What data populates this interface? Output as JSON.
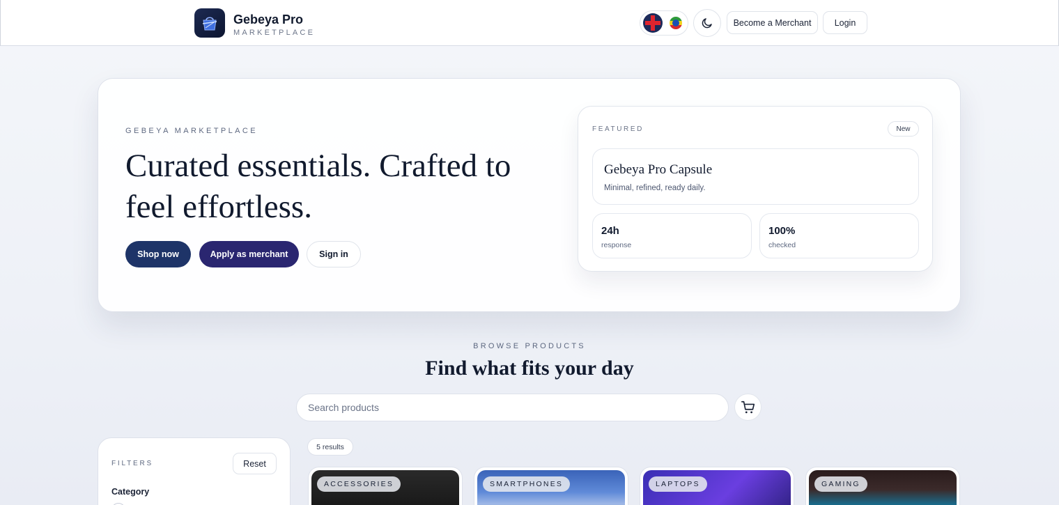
{
  "header": {
    "brand_name": "Gebeya Pro",
    "brand_sub": "MARKETPLACE",
    "become_merchant": "Become a Merchant",
    "login": "Login"
  },
  "hero": {
    "eyebrow": "GEBEYA MARKETPLACE",
    "title": "Curated essentials. Crafted to feel effortless.",
    "shop_now": "Shop now",
    "apply_merchant": "Apply as merchant",
    "sign_in": "Sign in",
    "featured": {
      "eyebrow": "FEATURED",
      "badge": "New",
      "title": "Gebeya Pro Capsule",
      "description": "Minimal, refined, ready daily.",
      "stats": [
        {
          "value": "24h",
          "label": "response"
        },
        {
          "value": "100%",
          "label": "checked"
        }
      ]
    }
  },
  "browse": {
    "eyebrow": "BROWSE PRODUCTS",
    "title": "Find what fits your day",
    "search_placeholder": "Search products"
  },
  "filters": {
    "eyebrow": "FILTERS",
    "reset": "Reset",
    "category_label": "Category"
  },
  "results": {
    "count_label": "5 results"
  },
  "products": [
    {
      "category": "ACCESSORIES"
    },
    {
      "category": "SMARTPHONES"
    },
    {
      "category": "LAPTOPS"
    },
    {
      "category": "GAMING"
    }
  ],
  "colors": {
    "primary_navy": "#1e3468",
    "primary_indigo": "#2a2670",
    "text_dark": "#111a2e"
  }
}
